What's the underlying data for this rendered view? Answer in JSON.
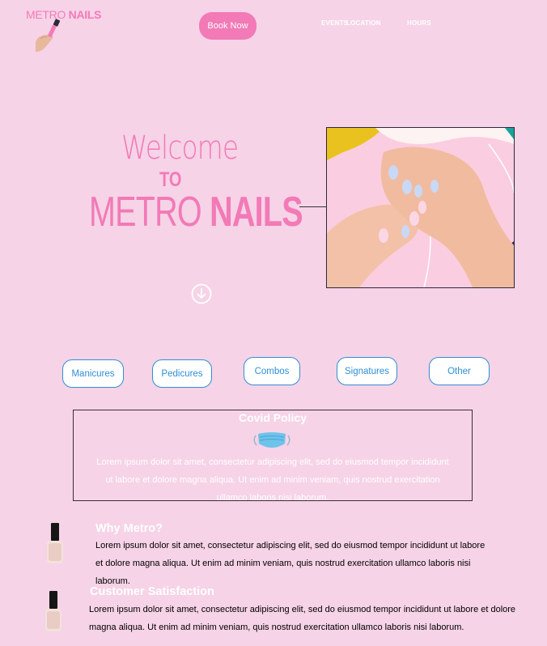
{
  "header": {
    "logo": {
      "light": "METRO ",
      "bold": "NAILS"
    },
    "book_button": "Book Now",
    "nav": [
      "EVENTS",
      "LOCATION",
      "HOURS"
    ]
  },
  "hero": {
    "welcome": "Welcome",
    "to": "TO",
    "brand_light": "METRO ",
    "brand_bold": "NAILS"
  },
  "categories": [
    "Manicures",
    "Pedicures",
    "Combos",
    "Signatures",
    "Other"
  ],
  "covid": {
    "title": "Covid Policy",
    "lines": [
      "Lorem ipsum dolor sit amet, consectetur adipiscing elit, sed do eiusmod tempor incididunt",
      "ut labore et dolore magna aliqua. Ut enim ad minim veniam, quis nostrud exercitation",
      "ullamco laboris nisi laborum."
    ]
  },
  "why": {
    "title": "Why Metro?",
    "lines": [
      "Lorem ipsum dolor sit amet, consectetur adipiscing elit, sed do eiusmod tempor incididunt ut labore",
      "et dolore magna aliqua. Ut enim ad minim veniam, quis nostrud exercitation ullamco laboris nisi",
      "laborum."
    ]
  },
  "satisfaction": {
    "title": "Customer Satisfaction",
    "lines": [
      "Lorem ipsum dolor sit amet, consectetur adipiscing elit, sed do eiusmod tempor incididunt ut labore et dolore",
      "magna aliqua. Ut enim ad minim veniam, quis nostrud exercitation ullamco laboris nisi laborum."
    ]
  },
  "icons": {
    "logo": "nail-polish-hand-icon",
    "scroll": "arrow-down-circle-icon",
    "mask": "face-mask-icon",
    "bottle": "nail-polish-bottle-icon"
  },
  "colors": {
    "background": "#f6d3e7",
    "brand_pink": "#f27ab6",
    "pill_blue": "#2f8fd4"
  }
}
